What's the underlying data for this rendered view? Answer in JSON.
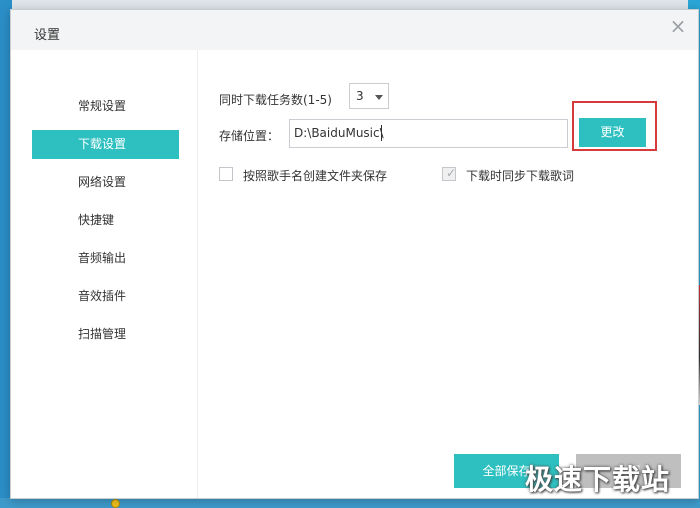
{
  "dialog": {
    "title": "设置",
    "close_label": "×"
  },
  "sidebar": {
    "items": [
      {
        "label": "常规设置",
        "active": false
      },
      {
        "label": "下载设置",
        "active": true
      },
      {
        "label": "网络设置",
        "active": false
      },
      {
        "label": "快捷键",
        "active": false
      },
      {
        "label": "音频输出",
        "active": false
      },
      {
        "label": "音效插件",
        "active": false
      },
      {
        "label": "扫描管理",
        "active": false
      }
    ]
  },
  "download": {
    "concurrent_label": "同时下载任务数(1-5)",
    "concurrent_value": "3",
    "storage_label": "存储位置：",
    "storage_path": "D:\\BaiduMusic\\",
    "change_button": "更改",
    "option_folder_by_singer": {
      "label": "按照歌手名创建文件夹保存",
      "checked": false
    },
    "option_sync_lyrics": {
      "label": "下载时同步下载歌词",
      "checked": true
    }
  },
  "footer": {
    "save_all": "全部保存",
    "close": "关闭"
  },
  "watermark": "极速下载站",
  "colors": {
    "accent": "#2ec0c0",
    "highlight": "#d63b3b",
    "disabled_button": "#bfbfbf"
  }
}
